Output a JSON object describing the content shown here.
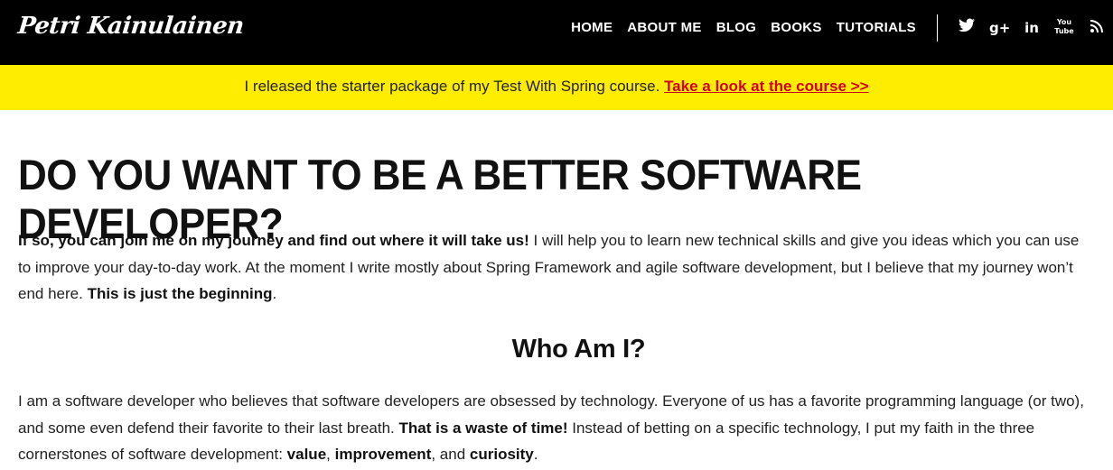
{
  "header": {
    "logo": "Petri Kainulainen",
    "nav": [
      "HOME",
      "ABOUT ME",
      "BLOG",
      "BOOKS",
      "TUTORIALS"
    ],
    "social_icons": [
      "twitter-icon",
      "google-plus-icon",
      "linkedin-icon",
      "youtube-icon",
      "rss-icon"
    ]
  },
  "banner": {
    "text": "I released the starter package of my Test With Spring course.",
    "link": "Take a look at the course >>"
  },
  "main": {
    "heading": "DO YOU WANT TO BE A BETTER SOFTWARE DEVELOPER?",
    "intro_bold": "If so, you can join me on my journey and find out where it will take us!",
    "intro_text": " I will help you to learn new technical skills and give you ideas which you can use to improve your day-to-day work. At the moment I write mostly about Spring Framework and agile software development, but I believe that my journey won’t end here. ",
    "intro_bold2": "This is just the beginning",
    "intro_end": ".",
    "subheading": "Who Am I?",
    "about_text1": "I am a software developer who believes that software developers are obsessed by technology. Everyone of us has a favorite programming language (or two), and some even defend their favorite to their last breath. ",
    "about_bold": "That is a waste of time!",
    "about_text2": " Instead of betting on a specific technology, I put my faith in the three cornerstones of software development: ",
    "value": "value",
    "sep1": ", ",
    "improvement": "improvement",
    "sep2": ", and ",
    "curiosity": "curiosity",
    "end": "."
  },
  "colors": {
    "topbar": "#000000",
    "banner": "#ffed00",
    "link": "#d0021b"
  }
}
